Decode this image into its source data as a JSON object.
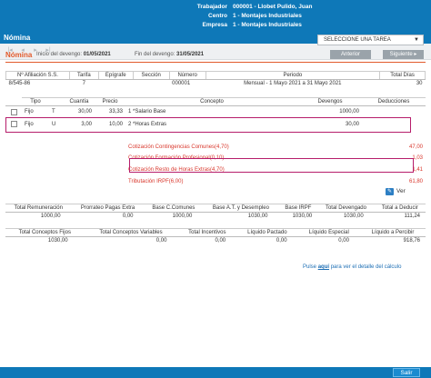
{
  "header": {
    "trabajador_label": "Trabajador",
    "trabajador_value": "000001 - Llobet Pulido, Juan",
    "centro_label": "Centro",
    "centro_value": "1 - Montajes Industriales",
    "empresa_label": "Empresa",
    "empresa_value": "1 - Montajes Industriales",
    "title": "Nómina"
  },
  "toolbar": {
    "task_select": "SELECCIONE UNA TAREA"
  },
  "nomina": {
    "title": "Nómina",
    "inicio_label": "Inicio del devengo:",
    "inicio_value": "01/05/2021",
    "fin_label": "Fin del devengo:",
    "fin_value": "31/05/2021",
    "anterior_label": "Anterior",
    "siguiente_label": "Siguiente ▸"
  },
  "info_table": {
    "headers": [
      "Nº Afiliación S.S.",
      "Tarifa",
      "Epígrafe",
      "Sección",
      "Número",
      "Periodo",
      "Total Días"
    ],
    "row": [
      "8/545-86",
      "7",
      "",
      "",
      "000001",
      "Mensual - 1 Mayo 2021 a 31 Mayo 2021",
      "30"
    ]
  },
  "concept_table": {
    "headers": [
      "Tipo",
      "Cuantía",
      "Precio",
      "Concepto",
      "Devengos",
      "Deducciones"
    ],
    "rows": [
      {
        "tipo": "Fijo",
        "t": "T",
        "cuantia": "30,00",
        "precio": "33,33",
        "num": "1",
        "concepto": "*Salario Base",
        "devengos": "1000,00",
        "deducciones": ""
      },
      {
        "tipo": "Fijo",
        "t": "U",
        "cuantia": "3,00",
        "precio": "10,00",
        "num": "2",
        "concepto": "*Horas Extras",
        "devengos": "30,00",
        "deducciones": ""
      }
    ],
    "red_rows": [
      {
        "concepto": "Cotización Contingencias Comunes(4,70)",
        "deducciones": "47,00"
      },
      {
        "concepto": "Cotización Formación Profesional(0,10)",
        "deducciones": "1,03"
      },
      {
        "concepto": "Cotización Resto de Horas Extras(4,70)",
        "deducciones": "1,41"
      },
      {
        "concepto": "Tributación IRPF(6,00)",
        "deducciones": "61,80"
      }
    ]
  },
  "ver_label": "Ver",
  "totals1": {
    "headers": [
      "Total Remuneración",
      "Prorrateo Pagas Extra",
      "Base C.Comunes",
      "Base A.T. y Desempleo",
      "Base IRPF",
      "Total Devengado",
      "Total a Deducir"
    ],
    "values": [
      "1000,00",
      "0,00",
      "1000,00",
      "1030,00",
      "1030,00",
      "1030,00",
      "111,24"
    ]
  },
  "totals2": {
    "headers": [
      "Total Conceptos Fijos",
      "Total Conceptos Variables",
      "Total Incentivos",
      "Líquido Pactado",
      "Líquido Especial",
      "Líquido a Percibir"
    ],
    "values": [
      "1030,00",
      "0,00",
      "0,00",
      "0,00",
      "0,00",
      "918,76"
    ]
  },
  "pulse": {
    "prefix": "Pulse",
    "link": "aquí",
    "suffix": "para ver el detalle del cálculo"
  },
  "footer": {
    "salir_label": "Salir"
  }
}
